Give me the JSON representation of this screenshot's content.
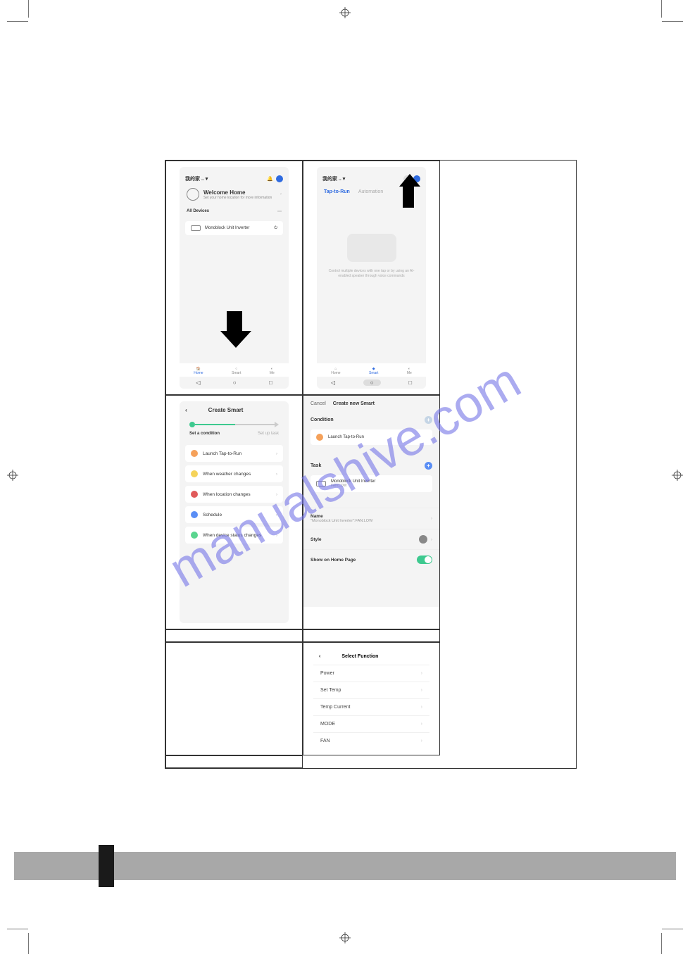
{
  "watermark": "manualshive.com",
  "cell1": {
    "home_label": "我的家 .. ▾",
    "welcome_title": "Welcome Home",
    "welcome_sub": "Set your home location for more information",
    "all_devices": "All Devices",
    "device": "Monoblock Unit Inverter",
    "nav_home": "Home",
    "nav_smart": "Smart",
    "nav_me": "Me"
  },
  "cell2": {
    "home_label": "我的家 .. ▾",
    "tab_tap": "Tap-to-Run",
    "tab_auto": "Automation",
    "caption": "Control multiple devices with one tap or by using an AI-enabled speaker through voice commands",
    "nav_home": "Home",
    "nav_smart": "Smart",
    "nav_me": "Me"
  },
  "cell3": {
    "title": "Create Smart",
    "step_a": "Set a condition",
    "step_b": "Set up task",
    "items": [
      "Launch Tap-to-Run",
      "When weather changes",
      "When location changes",
      "Schedule",
      "When device status changes"
    ]
  },
  "cell4": {
    "cancel": "Cancel",
    "title": "Create new Smart",
    "condition": "Condition",
    "cond_item": "Launch Tap-to-Run",
    "task": "Task",
    "task_device": "Monoblock Unit Inverter",
    "task_sub": "FAN:LOW",
    "name_label": "Name",
    "name_value": "\"Monoblock Unit Inverter\":FAN:LOW",
    "style_label": "Style",
    "show_label": "Show on Home Page"
  },
  "cell6": {
    "title": "Select Function",
    "items": [
      "Power",
      "Set Temp",
      "Temp Current",
      "MODE",
      "FAN"
    ]
  }
}
